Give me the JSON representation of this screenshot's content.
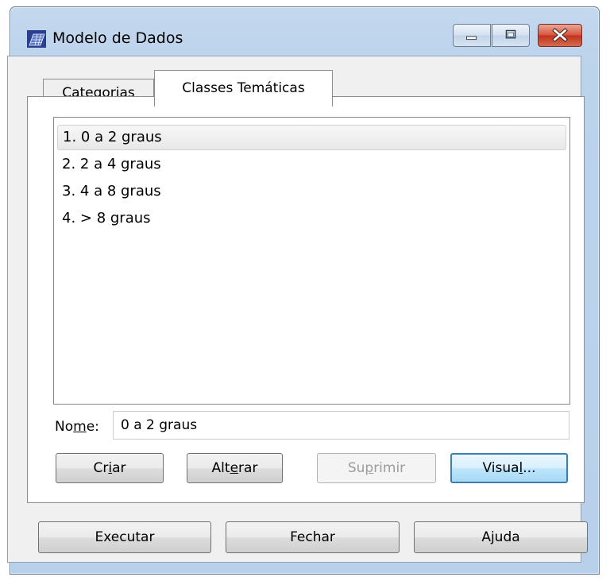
{
  "window": {
    "title": "Modelo de Dados",
    "icon": "grid-layer-icon",
    "controls": {
      "minimize": "minimize-icon",
      "maximize": "maximize-icon",
      "close": "close-icon"
    }
  },
  "tabs": {
    "items": [
      {
        "label": "Categorias",
        "active": false
      },
      {
        "label": "Classes Temáticas",
        "active": true
      }
    ]
  },
  "classes": {
    "selected_index": 0,
    "items": [
      "1. 0 a 2 graus",
      "2. 2 a 4 graus",
      "3. 4 a 8 graus",
      "4. > 8 graus"
    ]
  },
  "name_field": {
    "label_pre": "No",
    "label_mnemonic": "m",
    "label_post": "e:",
    "value": "0 a 2 graus"
  },
  "tab_buttons": {
    "create": {
      "pre": "Cr",
      "mnemonic": "i",
      "post": "ar"
    },
    "alter": {
      "pre": "Alt",
      "mnemonic": "e",
      "post": "rar"
    },
    "delete": {
      "pre": "Su",
      "mnemonic": "p",
      "post": "rimir",
      "disabled": true
    },
    "visual": {
      "pre": "Visua",
      "mnemonic": "l",
      "post": "..."
    }
  },
  "dialog_buttons": {
    "execute": "Executar",
    "close": "Fechar",
    "help": "Ajuda"
  }
}
